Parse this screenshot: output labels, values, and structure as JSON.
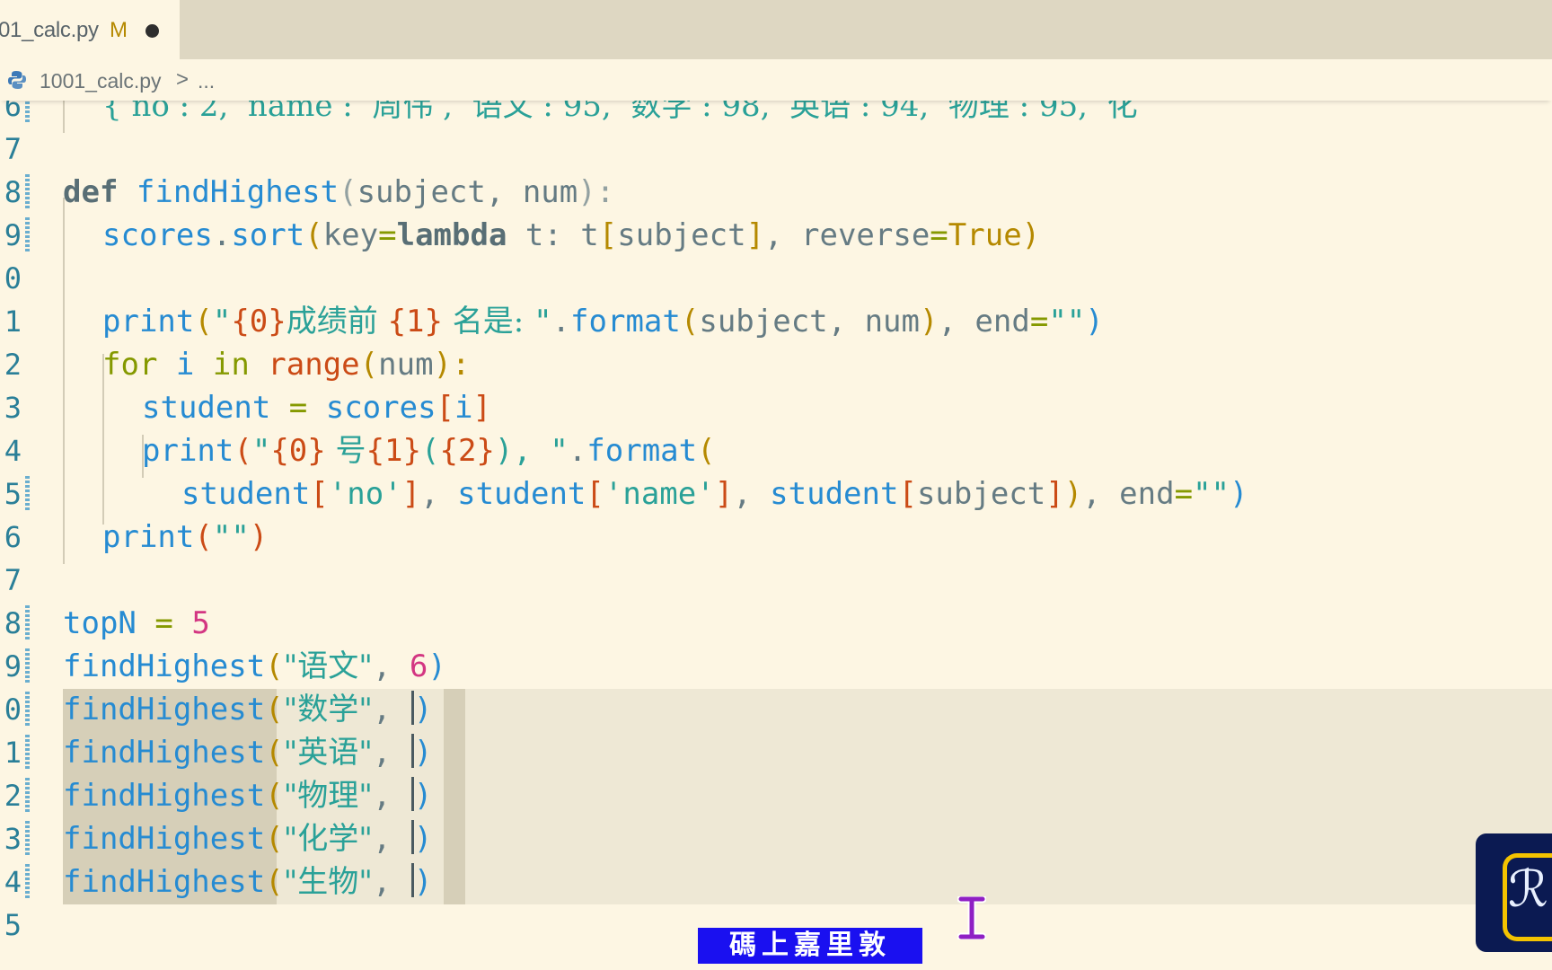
{
  "tab": {
    "filename": "01_calc.py",
    "modified": "M"
  },
  "breadcrumb": {
    "file": "1001_calc.py",
    "separator": ">",
    "more": "..."
  },
  "editor": {
    "lines": [
      {
        "n": "6"
      },
      {
        "n": "7"
      },
      {
        "n": "8"
      },
      {
        "n": "9"
      },
      {
        "n": "0"
      },
      {
        "n": "1"
      },
      {
        "n": "2"
      },
      {
        "n": "3"
      },
      {
        "n": "4"
      },
      {
        "n": "5"
      },
      {
        "n": "6"
      },
      {
        "n": "7"
      },
      {
        "n": "8"
      },
      {
        "n": "9"
      },
      {
        "n": "0"
      },
      {
        "n": "1"
      },
      {
        "n": "2"
      },
      {
        "n": "3"
      },
      {
        "n": "4"
      },
      {
        "n": "5"
      }
    ],
    "line6": {
      "t1": "{ no : 2,  name :  周伟 ,  语文 : 95,  数学 : 98,  英语 : 94,  物理 : 95,  化"
    },
    "line8": {
      "kw": "def",
      "fn": "findHighest",
      "p1": "(",
      "a": "subject",
      "c": ", ",
      "b": "num",
      "p2": "):"
    },
    "line9": {
      "obj": "scores",
      "dot": ".",
      "m": "sort",
      "p1": "(",
      "k": "key",
      "eq": "=",
      "lam": "lambda",
      "t1": " t: t",
      "b1": "[",
      "s": "subject",
      "b2": "]",
      "c": ", ",
      "rv": "reverse",
      "eq2": "=",
      "tr": "True",
      "p2": ")"
    },
    "line11": {
      "f": "print",
      "p1": "(",
      "q1": "\"",
      "f0": "{0}",
      "cn1": "成绩前 ",
      "f1": "{1}",
      "cn2": " 名是: ",
      "q2": "\"",
      "dot": ".",
      "m": "format",
      "p2": "(",
      "a": "subject, num",
      "p3": ")",
      "c": ", ",
      "e": "end",
      "eq": "=",
      "s": "\"\"",
      "p4": ")"
    },
    "line12": {
      "k1": "for",
      "v": " i ",
      "k2": "in",
      "sp": " ",
      "b": "range",
      "p1": "(",
      "a": "num",
      "p2": "):"
    },
    "line13": {
      "v": "student",
      "eq": " = ",
      "o": "scores",
      "b1": "[",
      "i": "i",
      "b2": "]"
    },
    "line14": {
      "f": "print",
      "p1": "(",
      "q1": "\"",
      "f0": "{0}",
      "cn": " 号",
      "f1": "{1}",
      "s1": "(",
      "f2": "{2}",
      "s2": "), ",
      "q2": "\"",
      "dot": ".",
      "m": "format",
      "p2": "("
    },
    "line15": {
      "v1": "student",
      "b1": "[",
      "s1": "'no'",
      "b2": "]",
      "c1": ", ",
      "v2": "student",
      "b3": "[",
      "s2": "'name'",
      "b4": "]",
      "c2": ", ",
      "v3": "student",
      "b5": "[",
      "s3": "subject",
      "b6": "]",
      "p1": ")",
      "c3": ", ",
      "e": "end",
      "eq": "=",
      "s": "\"\"",
      "p2": ")"
    },
    "line16": {
      "f": "print",
      "p1": "(",
      "s": "\"\"",
      "p2": ")"
    },
    "line18": {
      "v": "topN",
      "eq": " = ",
      "n": "5"
    },
    "line19": {
      "f": "findHighest",
      "p1": "(",
      "s": "\"语文\"",
      "c": ", ",
      "n": "6",
      "p2": ")"
    },
    "calls": [
      {
        "f": "findHighest",
        "p1": "(",
        "s": "\"数学\"",
        "c": ", ",
        "p2": ")"
      },
      {
        "f": "findHighest",
        "p1": "(",
        "s": "\"英语\"",
        "c": ", ",
        "p2": ")"
      },
      {
        "f": "findHighest",
        "p1": "(",
        "s": "\"物理\"",
        "c": ", ",
        "p2": ")"
      },
      {
        "f": "findHighest",
        "p1": "(",
        "s": "\"化学\"",
        "c": ", ",
        "p2": ")"
      },
      {
        "f": "findHighest",
        "p1": "(",
        "s": "\"生物\"",
        "c": ", ",
        "p2": ")"
      }
    ]
  },
  "watermark": {
    "text": "碼上嘉里敦"
  },
  "colors": {
    "background": "#fdf6e3",
    "tabbar": "#ded7c2",
    "keyword": "#586e75",
    "function": "#268bd2",
    "string": "#2aa198",
    "number": "#d33682",
    "control": "#859900",
    "watermark_bg": "#1a10f0",
    "logo_bg": "#0b1a52",
    "logo_accent": "#f4c300"
  },
  "icons": {
    "python": "python-file-icon",
    "cursor": "text-cursor-icon",
    "logo": "channel-logo-icon"
  }
}
